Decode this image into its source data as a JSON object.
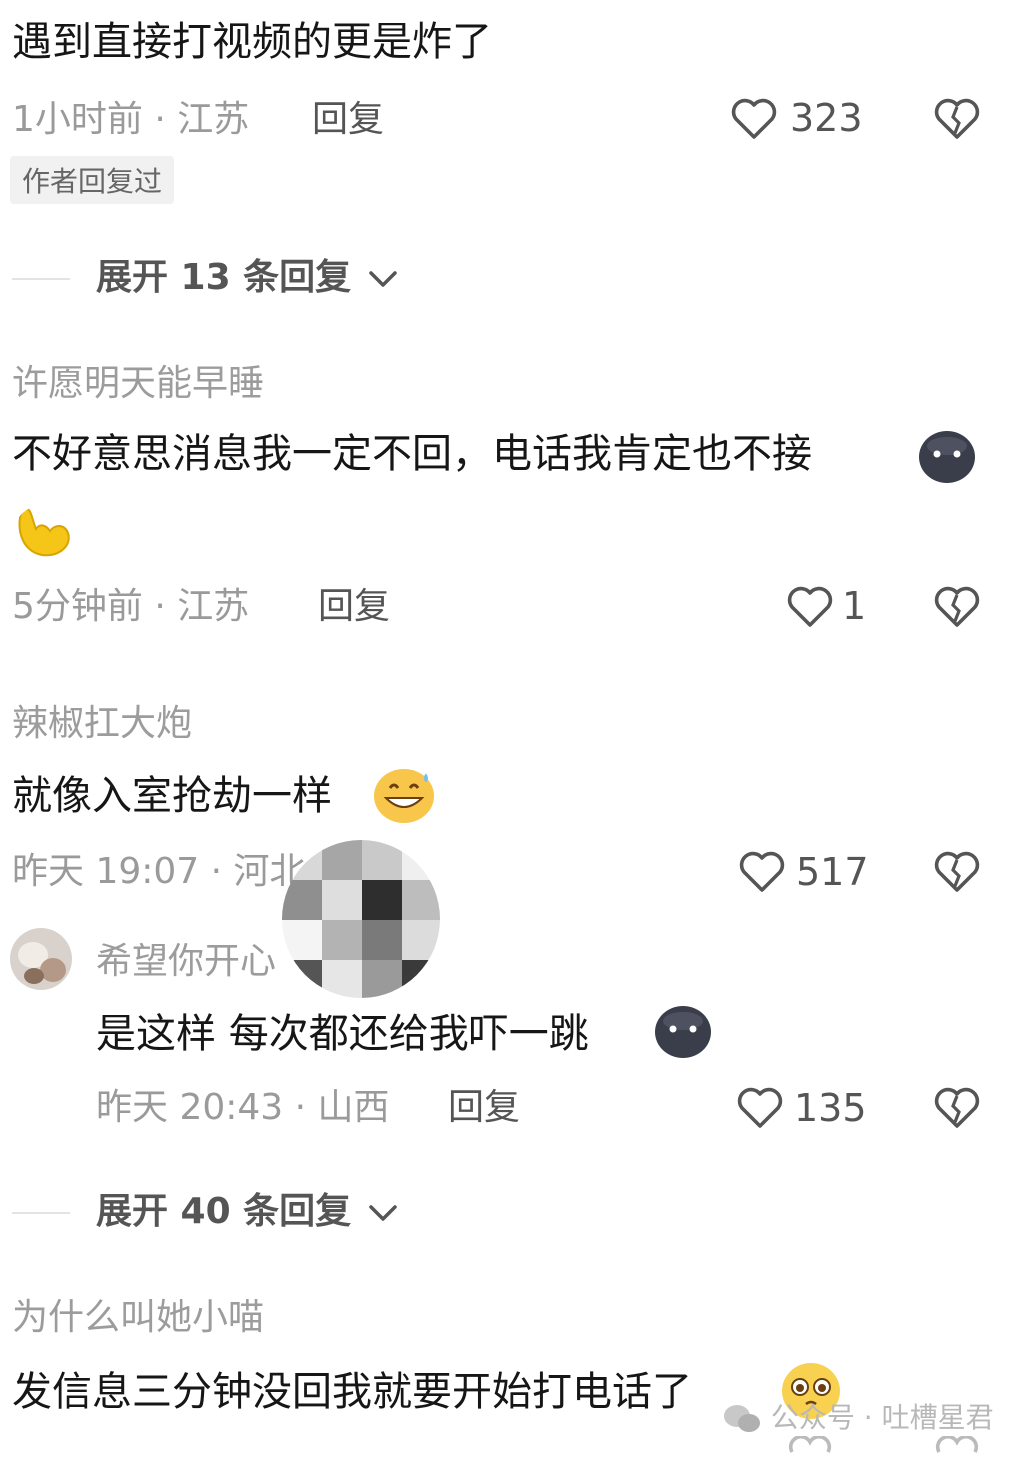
{
  "comments": [
    {
      "text": "遇到直接打视频的更是炸了",
      "meta": "1小时前 · 江苏",
      "reply": "回复",
      "likes": "323",
      "tag": "作者回复过",
      "expand": "展开 13 条回复"
    },
    {
      "user": "许愿明天能早睡",
      "text": "不好意思消息我一定不回，电话我肯定也不接",
      "meta": "5分钟前 · 江苏",
      "reply": "回复",
      "likes": "1"
    },
    {
      "user": "辣椒扛大炮",
      "text": "就像入室抢劫一样",
      "meta": "昨天 19:07 · 河北",
      "reply": "回复",
      "likes": "517",
      "sub_reply": {
        "user": "希望你开心",
        "text": "是这样 每次都还给我吓一跳",
        "meta": "昨天 20:43 · 山西",
        "reply": "回复",
        "likes": "135"
      },
      "expand": "展开 40 条回复"
    },
    {
      "user": "为什么叫她小喵",
      "text": "发信息三分钟没回我就要开始打电话了"
    }
  ],
  "watermark": "公众号 · 吐槽星君",
  "icons": [
    "heart-icon",
    "dislike-icon",
    "chevron-down-icon",
    "wechat-icon"
  ]
}
